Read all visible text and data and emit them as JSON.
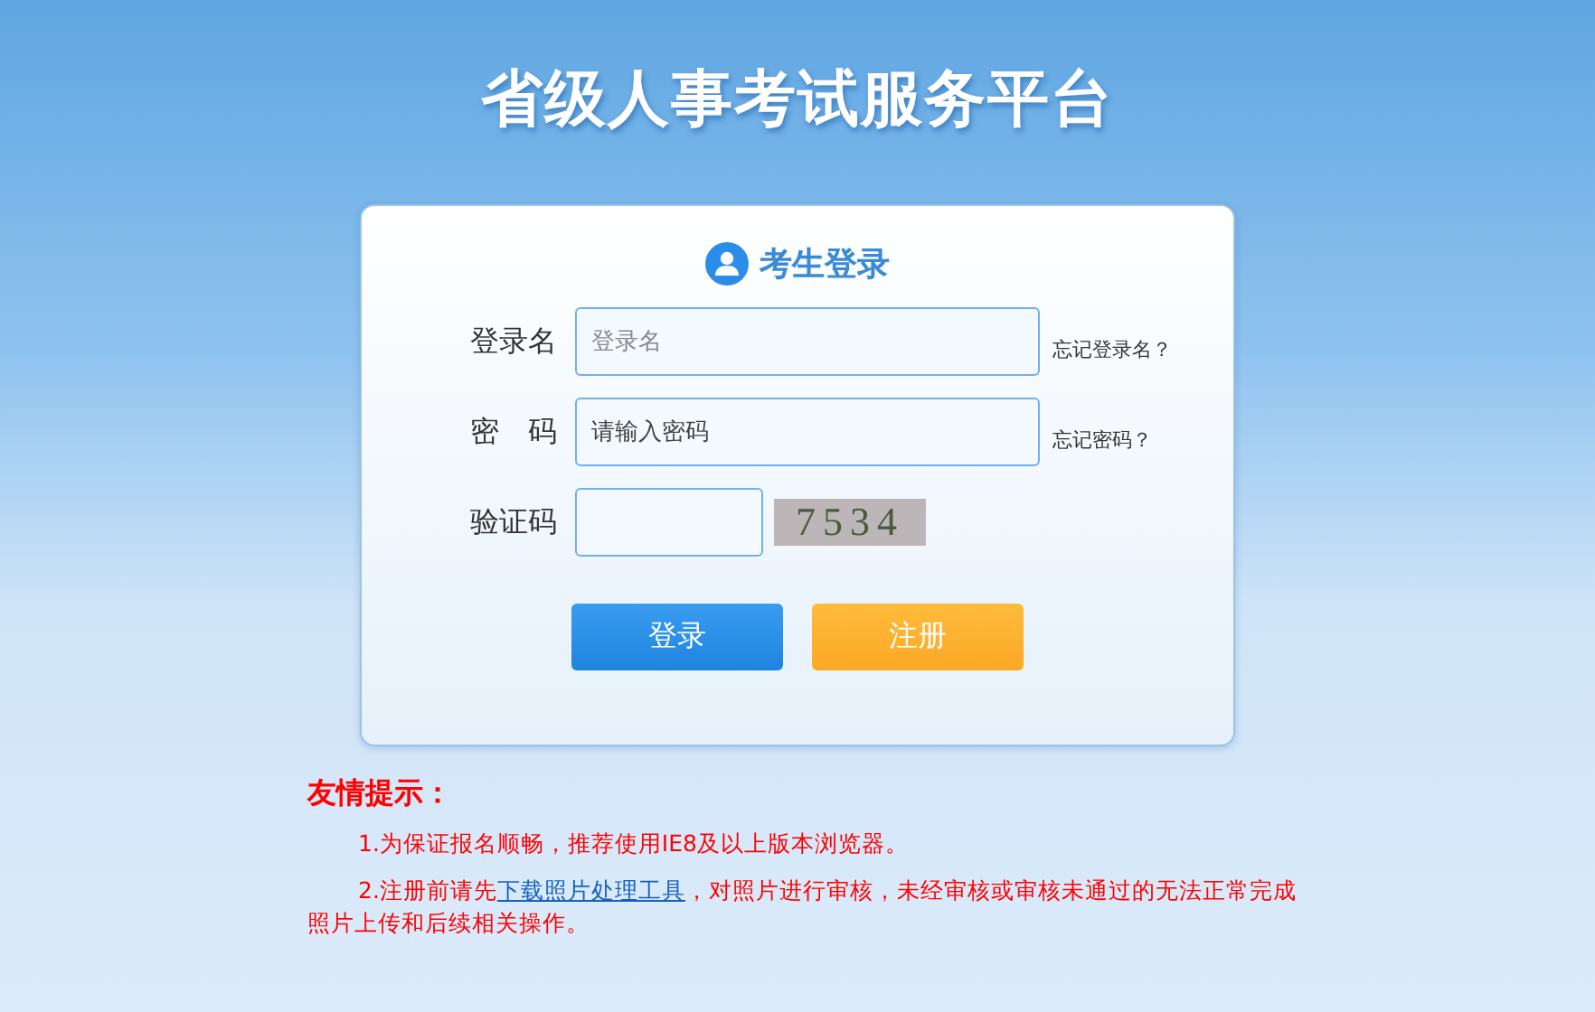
{
  "header": {
    "title": "省级人事考试服务平台"
  },
  "login": {
    "title": "考生登录",
    "fields": [
      {
        "label": "登录名",
        "placeholder": "登录名",
        "help": "忘记登录名？",
        "kind": "text"
      },
      {
        "label": "密　码",
        "value": "请输入密码",
        "help": "忘记密码？",
        "kind": "text"
      },
      {
        "label": "验证码",
        "kind": "captcha",
        "captcha": "7534"
      }
    ],
    "buttons": [
      {
        "label": "登录",
        "kind": "primary"
      },
      {
        "label": "注册",
        "kind": "secondary"
      }
    ]
  },
  "tips": {
    "title": "友情提示：",
    "items": [
      {
        "before": "1.为保证报名顺畅，推荐使用IE8及以上版本浏览器。"
      },
      {
        "before": "2.注册前请先",
        "link": "下载照片处理工具",
        "after": "，对照片进行审核，未经审核或审核未通过的无法正常完成照片上传和后续相关操作。"
      }
    ]
  }
}
